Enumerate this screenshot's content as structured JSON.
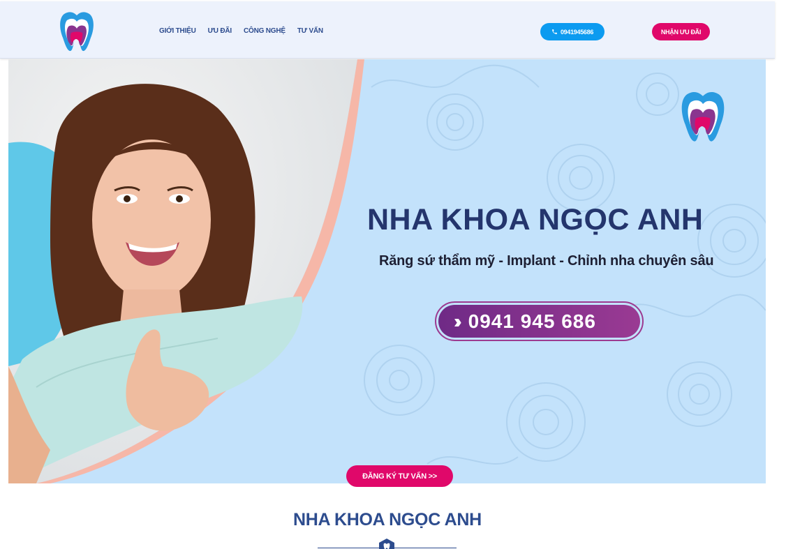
{
  "nav": {
    "items": [
      "GIỚI THIỆU",
      "ƯU ĐÃI",
      "CÔNG NGHỆ",
      "TƯ VẤN"
    ]
  },
  "header": {
    "phone_label": "0941945686",
    "promo_label": "NHẬN ƯU ĐÃI"
  },
  "banner": {
    "title": "NHA KHOA NGỌC ANH",
    "subtitle": "Răng sứ thẩm mỹ - Implant - Chỉnh nha chuyên sâu",
    "phone": "0941 945 686"
  },
  "cta": {
    "register_label": "ĐĂNG KÝ TƯ VẤN >>"
  },
  "section": {
    "title": "NHA KHOA NGỌC ANH"
  },
  "icons": {
    "logo": "tooth-logo-icon",
    "phone": "phone-icon",
    "chevrons": "double-chevron-right-icon",
    "divider": "tooth-badge-icon"
  },
  "colors": {
    "brand_navy": "#2d4c8e",
    "brand_pink": "#e0086a",
    "brand_blue": "#0c9bf0",
    "brand_purple": "#8a358f",
    "banner_bg": "#c3e2fb"
  }
}
